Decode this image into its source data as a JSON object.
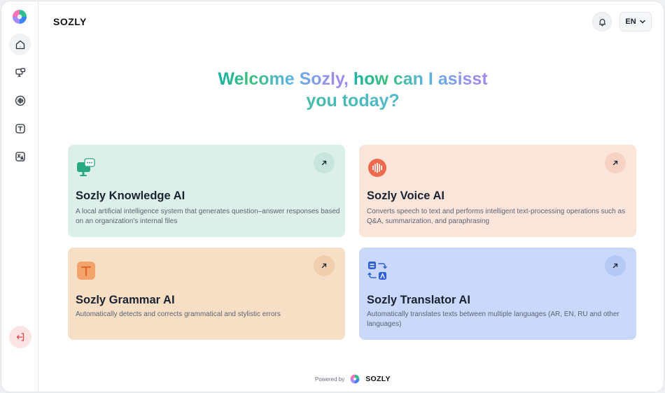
{
  "header": {
    "brand": "SOZLY",
    "language": "EN"
  },
  "welcome": {
    "part1": "Welcome Sozly,",
    "part2": "how can I asisst",
    "part3": "you today?"
  },
  "sidebar": {
    "items": [
      {
        "name": "home",
        "icon": "home-icon"
      },
      {
        "name": "knowledge",
        "icon": "chat-screen-icon"
      },
      {
        "name": "voice",
        "icon": "sound-wave-icon"
      },
      {
        "name": "grammar",
        "icon": "text-t-icon"
      },
      {
        "name": "translator",
        "icon": "translate-icon"
      }
    ],
    "logout_icon": "logout-icon"
  },
  "cards": [
    {
      "title": "Sozly Knowledge AI",
      "description": "A local artificial intelligence system that generates question–answer responses based on an organization's internal files",
      "icon": "chat-screen-icon",
      "color": "#dcefe9"
    },
    {
      "title": "Sozly Voice AI",
      "description": "Converts speech to text and performs intelligent text-processing operations such as Q&A, summarization, and paraphrasing",
      "icon": "sound-wave-icon",
      "color": "#fbe5db"
    },
    {
      "title": "Sozly Grammar AI",
      "description": "Automatically detects and corrects grammatical and stylistic errors",
      "icon": "text-t-icon",
      "color": "#f7dfc5"
    },
    {
      "title": "Sozly Translator AI",
      "description": "Automatically translates texts between multiple languages (AR, EN, RU and other languages)",
      "icon": "translate-icon",
      "color": "#c9d8fb"
    }
  ],
  "footer": {
    "powered_by": "Powered by",
    "brand": "SOZLY"
  }
}
